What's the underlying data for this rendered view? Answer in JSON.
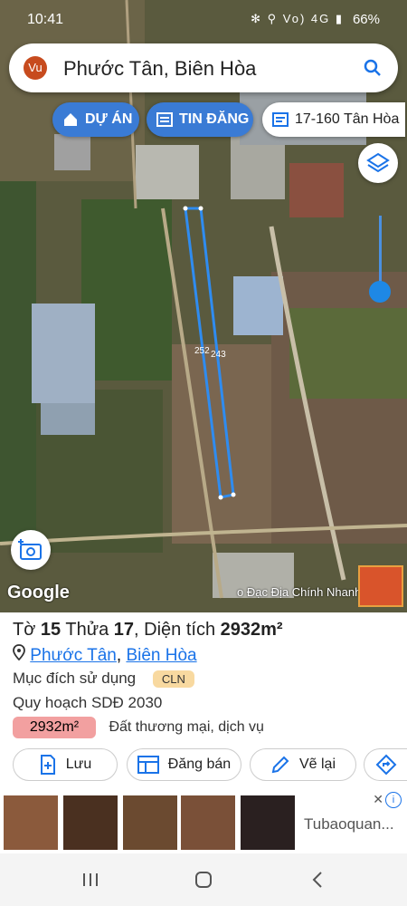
{
  "status": {
    "time": "10:41",
    "icons": "✻ ⚲ Vo) 4G ▮",
    "battery": "66%"
  },
  "search": {
    "avatar": "Vu",
    "query": "Phước Tân, Biên Hòa",
    "icon": "search-icon"
  },
  "chips": [
    {
      "label": "DỰ ÁN",
      "icon": "home-pin-icon"
    },
    {
      "label": "TIN ĐĂNG",
      "icon": "newspaper-icon"
    },
    {
      "label": "17-160 Tân Hòa",
      "icon": "map-sheet-icon"
    }
  ],
  "map": {
    "parcel_labels": [
      "252",
      "243"
    ],
    "google": "Google",
    "credit": "o Đạc Địa Chính Nhanh"
  },
  "panel": {
    "to_label": "Tờ",
    "to_num": "15",
    "thua_label": "Thửa",
    "thua_num": "17",
    "dien_tich_label": ", Diện tích",
    "area": "2932m²",
    "place1": "Phước Tân",
    "separator": ", ",
    "place2": "Biên Hòa",
    "purpose_label": "Mục đích sử dụng",
    "purpose_code": "CLN",
    "plan_label": "Quy hoạch SDĐ 2030",
    "plan_area": "2932m²",
    "plan_desc": "Đất thương mại, dịch vụ",
    "actions": {
      "save": "Lưu",
      "post": "Đăng bán",
      "redraw": "Vẽ lại"
    }
  },
  "ad": {
    "text": "Tubaoquan...",
    "close": "✕",
    "info": "i"
  },
  "colors": {
    "accent": "#3a7bd5",
    "parcel": "#2f8cf0",
    "link": "#1a73e8",
    "cln": "#f8d9a0",
    "plan": "#f2a0a0"
  }
}
